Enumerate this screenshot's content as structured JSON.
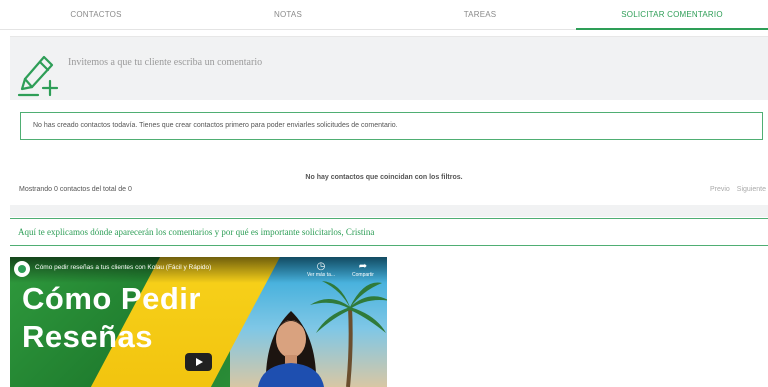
{
  "tabs": [
    {
      "label": "CONTACTOS",
      "active": false
    },
    {
      "label": "NOTAS",
      "active": false
    },
    {
      "label": "TAREAS",
      "active": false
    },
    {
      "label": "SOLICITAR COMENTARIO",
      "active": true
    }
  ],
  "invite": {
    "icon": "pencil-plus-icon",
    "text": "Invitemos a que tu cliente escriba un comentario"
  },
  "alert": {
    "text": "No has creado contactos todavía. Tienes que crear contactos primero para poder enviarles solicitudes de comentario."
  },
  "table": {
    "empty_text": "No hay contactos que coincidan con los filtros.",
    "showing_text": "Mostrando 0 contactos del total de 0",
    "prev_label": "Previo",
    "next_label": "Siguiente"
  },
  "explanation": {
    "text": "Aquí te explicamos dónde aparecerán los comentarios y por qué es importante solicitarlos, Cristina"
  },
  "video": {
    "title": "Cómo pedir reseñas a tus clientes con Kolau (Fácil y Rápido)",
    "watch_later_label": "Ver más ta...",
    "share_label": "Compartir",
    "headline_line1": "Cómo Pedir",
    "headline_line2": "Reseñas",
    "icons": [
      "channel-logo-icon",
      "clock-icon",
      "share-icon",
      "play-icon"
    ],
    "colors": {
      "green": "#2f9a3d",
      "yellow": "#f7d21b",
      "sky": "#2ba6d8"
    }
  },
  "colors": {
    "accent": "#2e9e57",
    "panel": "#f1f2f3"
  }
}
